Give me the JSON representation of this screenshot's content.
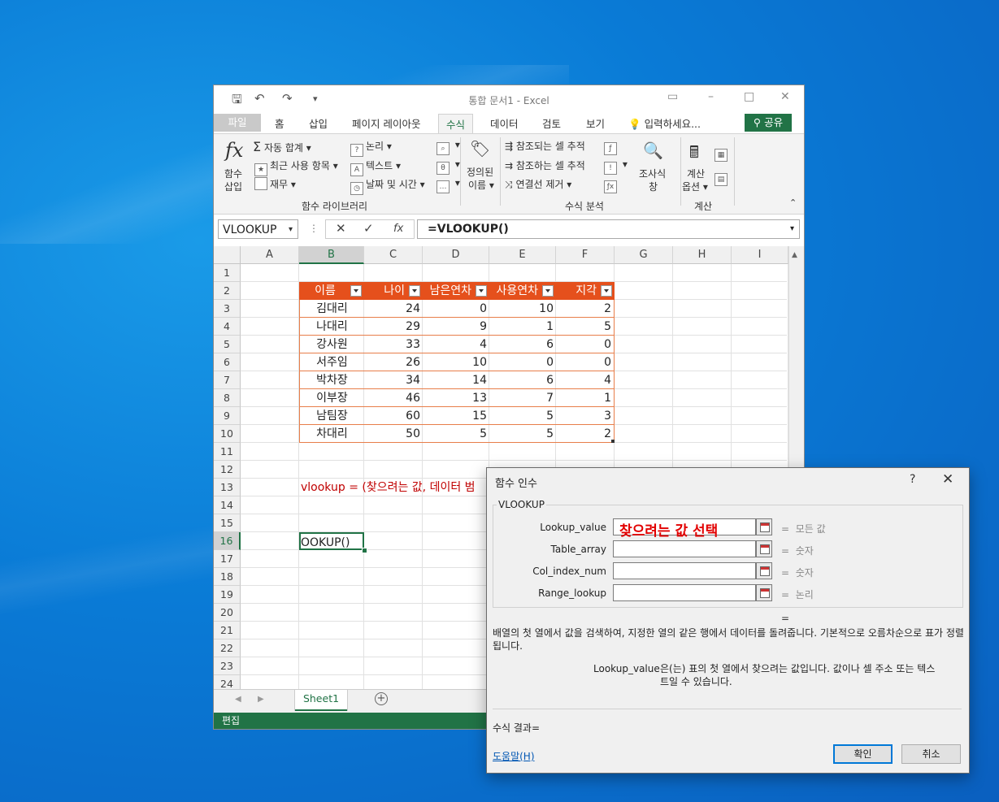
{
  "window": {
    "title": "통합 문서1 - Excel",
    "tabs": [
      "파일",
      "홈",
      "삽입",
      "페이지 레이아웃",
      "수식",
      "데이터",
      "검토",
      "보기"
    ],
    "active_tab": "수식",
    "tell_me": "입력하세요...",
    "share": "공유"
  },
  "ribbon": {
    "fx_top": "함수",
    "fx_bottom": "삽입",
    "autosum": "자동 합계",
    "recent": "최근 사용 항목",
    "finance": "재무",
    "logical": "논리",
    "text": "텍스트",
    "datetime": "날짜 및 시간",
    "defined_top": "정의된",
    "defined_bottom": "이름",
    "trace_prec": "참조되는 셀 추적",
    "trace_dep": "참조하는 셀 추적",
    "remove_arrows": "연결선 제거",
    "watch_top": "조사식",
    "watch_bottom": "창",
    "calc_top": "계산",
    "calc_bottom": "옵션",
    "group_library": "함수 라이브러리",
    "group_audit": "수식 분석",
    "group_calc": "계산"
  },
  "formula_bar": {
    "name_box": "VLOOKUP",
    "formula": "=VLOOKUP()"
  },
  "columns": [
    "A",
    "B",
    "C",
    "D",
    "E",
    "F",
    "G",
    "H",
    "I"
  ],
  "rows": [
    "1",
    "2",
    "3",
    "4",
    "5",
    "6",
    "7",
    "8",
    "9",
    "10",
    "11",
    "12",
    "13",
    "14",
    "15",
    "16",
    "17",
    "18",
    "19",
    "20",
    "21",
    "22",
    "23",
    "24"
  ],
  "table": {
    "headers": [
      "이름",
      "나이",
      "남은연차",
      "사용연차",
      "지각"
    ],
    "rows": [
      [
        "김대리",
        "24",
        "0",
        "10",
        "2"
      ],
      [
        "나대리",
        "29",
        "9",
        "1",
        "5"
      ],
      [
        "강사원",
        "33",
        "4",
        "6",
        "0"
      ],
      [
        "서주임",
        "26",
        "10",
        "0",
        "0"
      ],
      [
        "박차장",
        "34",
        "14",
        "6",
        "4"
      ],
      [
        "이부장",
        "46",
        "13",
        "7",
        "1"
      ],
      [
        "남팀장",
        "60",
        "15",
        "5",
        "3"
      ],
      [
        "차대리",
        "50",
        "5",
        "5",
        "2"
      ]
    ]
  },
  "cell_b13": "vlookup = (찾으려는 값, 데이터 범",
  "cell_b16": "OOKUP()",
  "sheet_tab": "Sheet1",
  "status": "편집",
  "dialog": {
    "title": "함수 인수",
    "help_q": "?",
    "function": "VLOOKUP",
    "args": [
      {
        "label": "Lookup_value",
        "result": "모든 값"
      },
      {
        "label": "Table_array",
        "result": "숫자"
      },
      {
        "label": "Col_index_num",
        "result": "숫자"
      },
      {
        "label": "Range_lookup",
        "result": "논리"
      }
    ],
    "annotation": "찾으려는 값 선택",
    "eq_result": "=",
    "description": "배열의 첫 열에서 값을 검색하여, 지정한 열의 같은 행에서 데이터를 돌려줍니다. 기본적으로 오름차순으로 표가 정렬됩니다.",
    "arg_name": "Lookup_value",
    "arg_desc": "은(는) 표의 첫 열에서 찾으려는 값입니다. 값이나 셀 주소 또는 텍스트일 수 있습니다.",
    "result_label": "수식 결과=",
    "help_link": "도움말(H)",
    "ok": "확인",
    "cancel": "취소"
  },
  "colors": {
    "excel_green": "#217346",
    "table_header": "#e5501c",
    "annotation": "#e20000"
  }
}
